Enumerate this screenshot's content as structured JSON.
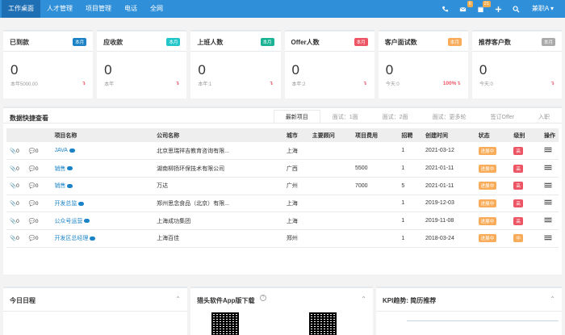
{
  "nav": {
    "items": [
      "工作桌面",
      "人才管理",
      "项目管理",
      "电话",
      "全网"
    ],
    "badges": {
      "mail": "6",
      "calendar": "21"
    },
    "user": "兼职A"
  },
  "cards": [
    {
      "title": "已到款",
      "tag": "本月",
      "tag_color": "#1c84c6",
      "num": "0",
      "sub": "本年5000.00",
      "pct": ""
    },
    {
      "title": "应收款",
      "tag": "本月",
      "tag_color": "#23c6c8",
      "num": "0",
      "sub": "本年",
      "pct": ""
    },
    {
      "title": "上班人数",
      "tag": "本月",
      "tag_color": "#1ab394",
      "num": "0",
      "sub": "本年:1",
      "pct": ""
    },
    {
      "title": "Offer人数",
      "tag": "本月",
      "tag_color": "#ed5565",
      "num": "0",
      "sub": "本年:2",
      "pct": ""
    },
    {
      "title": "客户面试数",
      "tag": "本月",
      "tag_color": "#f8ac59",
      "num": "0",
      "sub": "今天:0",
      "pct": "100%"
    },
    {
      "title": "推荐客户数",
      "tag": "本月",
      "tag_color": "#aaaaaa",
      "num": "0",
      "sub": "今天:0",
      "pct": ""
    }
  ],
  "panel": {
    "title": "数据快捷查看",
    "tabs": [
      "最新项目",
      "面试：1面",
      "面试：2面",
      "面试：更多轮",
      "签订Offer",
      "入职"
    ]
  },
  "table": {
    "headers": [
      "",
      "项目名称",
      "公司名称",
      "城市",
      "主要顾问",
      "项目费用",
      "招聘",
      "创建时间",
      "状态",
      "级别",
      "操作"
    ],
    "rows": [
      {
        "attach": "0",
        "comments": "0",
        "name": "JAVA",
        "company": "北京思瑞祥吉教育咨询有限...",
        "city": "上海",
        "advisor": "",
        "fee": "",
        "hire": "1",
        "date": "2021-03-12",
        "status": "进展中",
        "level": "高",
        "level_color": "#ed5565"
      },
      {
        "attach": "0",
        "comments": "0",
        "name": "销售",
        "company": "湖南柳扬环保技术有限公司",
        "city": "广西",
        "advisor": "",
        "fee": "5500",
        "hire": "1",
        "date": "2021-01-11",
        "status": "进展中",
        "level": "高",
        "level_color": "#ed5565"
      },
      {
        "attach": "0",
        "comments": "0",
        "name": "销售",
        "company": "万达",
        "city": "广州",
        "advisor": "",
        "fee": "7000",
        "hire": "5",
        "date": "2021-01-11",
        "status": "进展中",
        "level": "高",
        "level_color": "#ed5565"
      },
      {
        "attach": "0",
        "comments": "0",
        "name": "开发总监",
        "company": "郑州思念食品（北京）有限...",
        "city": "上海",
        "advisor": "",
        "fee": "",
        "hire": "1",
        "date": "2019-12-03",
        "status": "进展中",
        "level": "高",
        "level_color": "#ed5565"
      },
      {
        "attach": "0",
        "comments": "0",
        "name": "公众号运营",
        "company": "上海成功集团",
        "city": "上海",
        "advisor": "",
        "fee": "",
        "hire": "1",
        "date": "2019-11-08",
        "status": "进展中",
        "level": "高",
        "level_color": "#ed5565"
      },
      {
        "attach": "0",
        "comments": "0",
        "name": "开发区总经理",
        "company": "上海百佳",
        "city": "郑州",
        "advisor": "",
        "fee": "",
        "hire": "1",
        "date": "2018-03-24",
        "status": "进展中",
        "level": "中",
        "level_color": "#f8ac59"
      }
    ]
  },
  "bottom": {
    "schedule_title": "今日日程",
    "app_title": "猎头软件App版下载",
    "kpi_title": "KPI趋势: 简历推荐"
  }
}
